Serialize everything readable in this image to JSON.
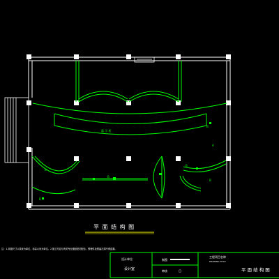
{
  "drawing": {
    "plan_title": "平 面 结 构 图",
    "plan_title_display": "平  面  结  构  图",
    "notes_text": "注：1.本图尺寸以毫米为单位，标高以米为单位。2.施工时应与有关专业图纸密切配合，预埋件及预留孔洞不得遗漏。",
    "labels": {
      "center_band": "展 示 柜",
      "left_arc": "B",
      "bottom_left": "B",
      "center_line": "B",
      "right_arc_top": "B",
      "right_arc_label": "B",
      "right_label": "B",
      "right_small": "A"
    }
  },
  "title_block": {
    "col1_top": "设计单位",
    "col1_bottom": "设计室",
    "col2_top_label": "制图",
    "col2_bottom_label": "审核",
    "col2_bottom_value": "日",
    "project_name_label": "工程项目名称",
    "drawing_title_label": "DRAWING TITLE",
    "drawing_title": "平 面 结 构 图"
  },
  "colors": {
    "background": "#000000",
    "wall": "#ffffff",
    "furniture": "#00ff00",
    "accent": "#ffff00"
  }
}
